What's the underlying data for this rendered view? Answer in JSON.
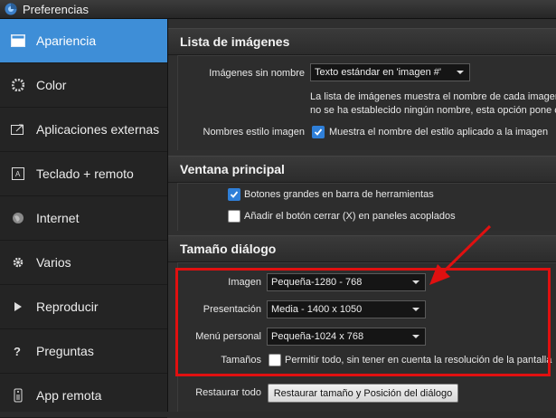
{
  "window": {
    "title": "Preferencias"
  },
  "sidebar": {
    "items": [
      {
        "label": "Apariencia",
        "icon": "appearance-icon",
        "active": true
      },
      {
        "label": "Color",
        "icon": "color-wheel-icon"
      },
      {
        "label": "Aplicaciones externas",
        "icon": "external-app-icon"
      },
      {
        "label": "Teclado + remoto",
        "icon": "keyboard-icon"
      },
      {
        "label": "Internet",
        "icon": "globe-icon"
      },
      {
        "label": "Varios",
        "icon": "gear-icon"
      },
      {
        "label": "Reproducir",
        "icon": "play-icon"
      },
      {
        "label": "Preguntas",
        "icon": "question-icon"
      },
      {
        "label": "App remota",
        "icon": "remote-icon"
      }
    ]
  },
  "image_list": {
    "header": "Lista de imágenes",
    "names_label": "Imágenes sin nombre",
    "names_value": "Texto estándar en 'imagen #'",
    "description_line1": "La lista de imágenes muestra el nombre de cada imagen",
    "description_line2": "no se ha establecido ningún nombre, esta opción pone c",
    "style_label": "Nombres estilo imagen",
    "style_checkbox": {
      "label": "Muestra el nombre del estilo aplicado a la imagen",
      "checked": true
    }
  },
  "main_window": {
    "header": "Ventana principal",
    "big_buttons": {
      "label": "Botones grandes en barra de herramientas",
      "checked": true
    },
    "close_button": {
      "label": "Añadir el botón cerrar (X) en paneles acoplados",
      "checked": false
    }
  },
  "dialog_size": {
    "header": "Tamaño diálogo",
    "image_label": "Imagen",
    "image_value": "Pequeña-1280 - 768",
    "presentation_label": "Presentación",
    "presentation_value": "Media  - 1400 x 1050",
    "menu_label": "Menú personal",
    "menu_value": "Pequeña-1024 x 768",
    "sizes_label": "Tamaños",
    "allow_all": {
      "label": "Permitir todo, sin tener en cuenta la resolución de la pantalla",
      "checked": false
    },
    "restore_label": "Restaurar todo",
    "restore_button": "Restaurar tamaño y Posición del diálogo"
  },
  "colors": {
    "accent": "#3e8ed7",
    "highlight_box": "#e01010",
    "arrow": "#e01010"
  }
}
